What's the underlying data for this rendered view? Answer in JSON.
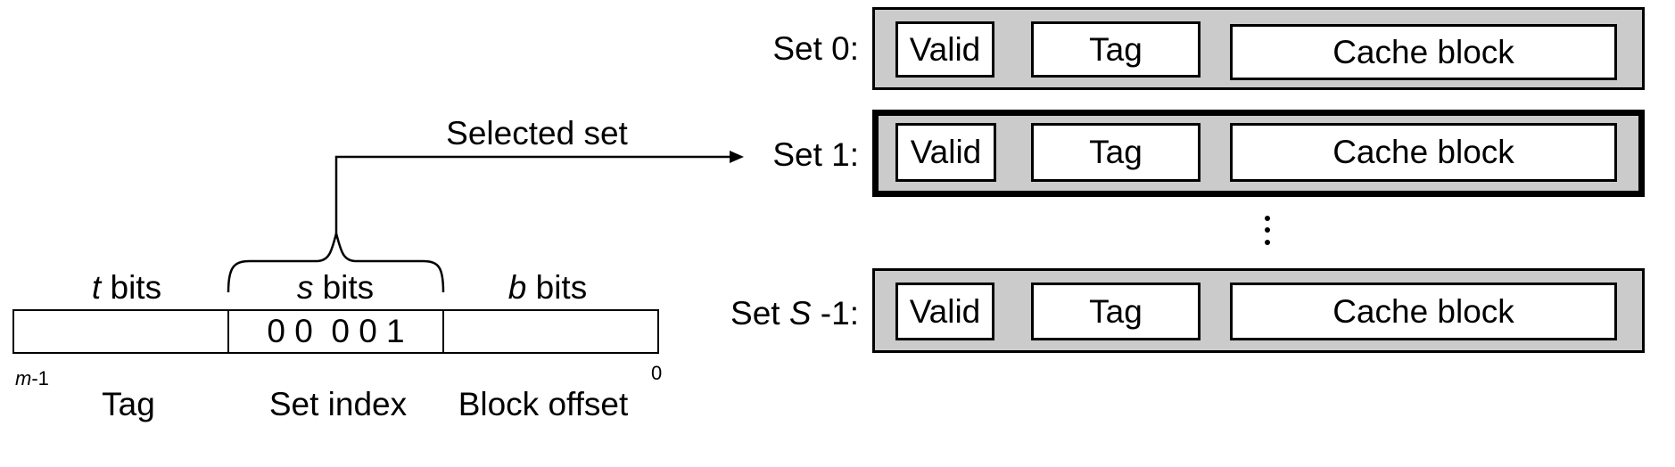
{
  "address": {
    "field_widths_labels": [
      {
        "top": "t",
        "top_suffix": " bits",
        "bottom": "Tag",
        "value": ""
      },
      {
        "top": "s",
        "top_suffix": " bits",
        "bottom": "Set index",
        "value": "0 0  0 0 1"
      },
      {
        "top": "b",
        "top_suffix": " bits",
        "bottom": "Block offset",
        "value": ""
      }
    ],
    "msb_label_var": "m",
    "msb_label_suffix": "-1",
    "lsb_label": "0"
  },
  "arrow_label": "Selected set",
  "sets": [
    {
      "prefix": "Set ",
      "var": "",
      "suffix": "0:",
      "selected": false,
      "cells": [
        "Valid",
        "Tag",
        "Cache block"
      ]
    },
    {
      "prefix": "Set ",
      "var": "",
      "suffix": "1:",
      "selected": true,
      "cells": [
        "Valid",
        "Tag",
        "Cache block"
      ]
    },
    {
      "prefix": "Set ",
      "var": "S",
      "suffix": " -1:",
      "selected": false,
      "cells": [
        "Valid",
        "Tag",
        "Cache block"
      ]
    }
  ],
  "ellipsis": "⋮",
  "colors": {
    "set_fill": "#cbcbcb",
    "line": "#000000"
  }
}
